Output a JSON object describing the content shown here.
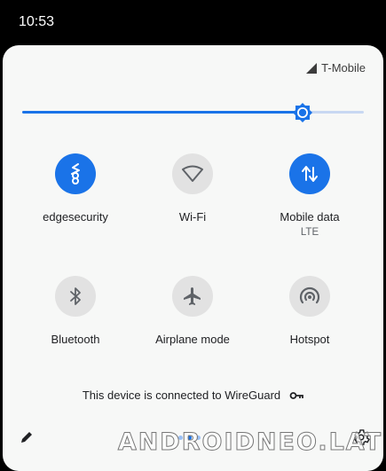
{
  "status_bar": {
    "time": "10:53"
  },
  "carrier": {
    "name": "T-Mobile",
    "icon": "signal-icon"
  },
  "brightness": {
    "level_percent": 82,
    "color": "#1a73e8"
  },
  "tiles": [
    {
      "label": "edgesecurity",
      "sublabel": "",
      "icon": "edgesecurity-icon",
      "state": "on"
    },
    {
      "label": "Wi-Fi",
      "sublabel": "",
      "icon": "wifi-icon",
      "state": "off"
    },
    {
      "label": "Mobile data",
      "sublabel": "LTE",
      "icon": "mobile-data-icon",
      "state": "on"
    },
    {
      "label": "Bluetooth",
      "sublabel": "",
      "icon": "bluetooth-icon",
      "state": "off"
    },
    {
      "label": "Airplane mode",
      "sublabel": "",
      "icon": "airplane-icon",
      "state": "off"
    },
    {
      "label": "Hotspot",
      "sublabel": "",
      "icon": "hotspot-icon",
      "state": "off"
    }
  ],
  "vpn": {
    "text": "This device is connected to WireGuard",
    "icon": "vpn-key-icon"
  },
  "footer": {
    "page_count": 3,
    "active_page": 1
  },
  "watermark": {
    "text": "ANDROIDNEO.LAT"
  },
  "colors": {
    "accent": "#1a73e8",
    "tile_off": "#e2e2e2",
    "panel_bg": "#f7f8f7"
  }
}
